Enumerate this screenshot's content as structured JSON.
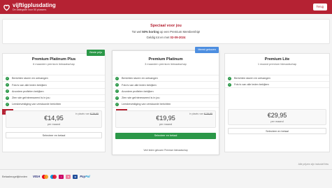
{
  "header": {
    "logo_name": "vijftigplusdating",
    "logo_tagline": "De datingsite voor 50 plussers",
    "back_label": "Terug",
    "brand_color": "#b52233"
  },
  "promo": {
    "title": "Speciaal voor jou",
    "line_pre": "Tot wel ",
    "line_bold": "50% korting",
    "line_post": " op een Premium Membership!",
    "valid_pre": "Geldig tot en met ",
    "valid_date": "02-09-2024"
  },
  "plans": [
    {
      "name": "Premium Platinum Plus",
      "subtitle": "6 maanden premium lidmaatschap",
      "badge": "Beste prijs",
      "badge_color": "#2b9848",
      "features": [
        "Berichten sturen en ontvangen",
        "Foto's van alle leden bekijken",
        "Anoniem profielen bekijken",
        "Zien wie geïnteresseerd is in jou",
        "Leesbevestiging van verstuurde berichten"
      ],
      "discount": "- 50%",
      "was_label": "in plaats van",
      "was_price": "€ 29,95",
      "price": "€14,95",
      "per": "per maand",
      "button": "Selecteer en betaal"
    },
    {
      "name": "Premium Platinum",
      "subtitle": "3 maanden premium lidmaatschap",
      "badge": "Meest gekozen",
      "badge_color": "#4d8ee0",
      "features": [
        "Berichten sturen en ontvangen",
        "Foto's van alle leden bekijken",
        "Anoniem profielen bekijken",
        "Zien wie geïnteresseerd is in jou",
        "Leesbevestiging van verstuurde berichten"
      ],
      "discount": "- 33%",
      "was_label": "in plaats van",
      "was_price": "€ 29,95",
      "price": "€19,95",
      "per": "per maand",
      "button": "Selecteer en betaal",
      "note": "Veel leden gekozen Premium lidmaatschap"
    },
    {
      "name": "Premium Lite",
      "subtitle": "1 maand premium lidmaatschap",
      "features": [
        "Berichten sturen en ontvangen",
        "Foto's van alle leden bekijken"
      ],
      "price": "€29,95",
      "per": "per maand",
      "button": "Selecteer en betaal"
    }
  ],
  "footnote": "Alle prijzen zijn inclusief btw",
  "footer": {
    "payment_label": "Betaalmogelijkheden",
    "methods": [
      "VISA",
      "Mastercard",
      "Maestro",
      "iDEAL",
      "Sofort",
      "Bancontact",
      "PayPal"
    ],
    "paypal_a": "Pay",
    "paypal_b": "Pal",
    "visa": "VISA"
  }
}
